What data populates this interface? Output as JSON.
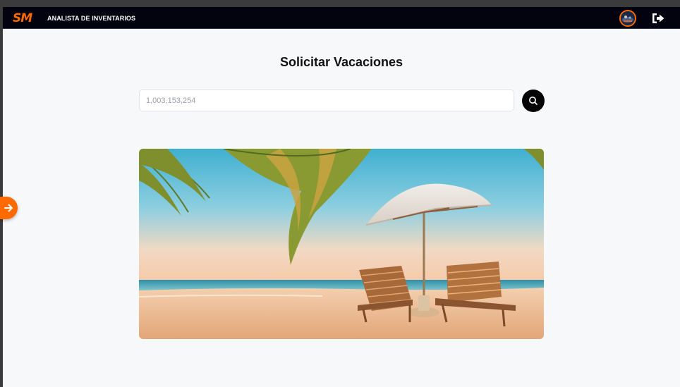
{
  "app": {
    "logo_text": "SM",
    "role_label": "ANALISTA DE INVENTARIOS"
  },
  "page": {
    "title": "Solicitar Vacaciones"
  },
  "search": {
    "placeholder": "1,003,153,254"
  },
  "icons": {
    "logout": "logout-icon",
    "search": "search-icon",
    "sidebar_toggle": "arrow-right-icon",
    "avatar": "user-avatar"
  },
  "colors": {
    "navbar": "#02030f",
    "accent": "#ff6a00",
    "page_bg": "#f7f8fa",
    "search_button": "#050505"
  }
}
